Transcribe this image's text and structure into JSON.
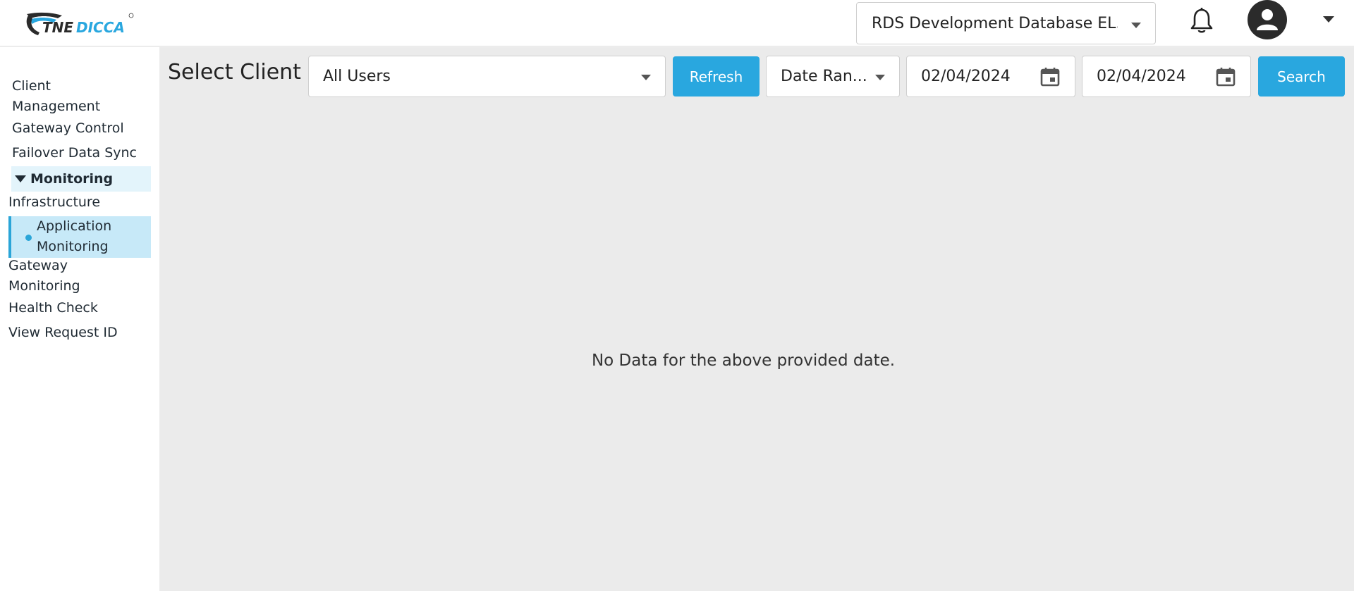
{
  "brand": {
    "logo_text": "TNEDICCA"
  },
  "header": {
    "database_select": "RDS Development Database EL...",
    "notifications_icon": "bell-icon",
    "user_icon": "user-avatar-icon"
  },
  "sidebar": {
    "items": [
      {
        "label": "Client\nManagement"
      },
      {
        "label": "Gateway Control"
      },
      {
        "label": "Failover Data Sync"
      },
      {
        "label": "Monitoring"
      },
      {
        "label": "Infrastructure"
      },
      {
        "label": "Application\nMonitoring"
      },
      {
        "label": "Gateway\nMonitoring"
      },
      {
        "label": "Health Check"
      },
      {
        "label": "View Request ID"
      }
    ]
  },
  "toolbar": {
    "select_client_label": "Select Client",
    "client_select": "All Users",
    "refresh_label": "Refresh",
    "date_range_select": "Date Ran...",
    "start_date": "02/04/2024",
    "end_date": "02/04/2024",
    "search_label": "Search"
  },
  "main": {
    "empty_message": "No Data for the above provided date."
  },
  "colors": {
    "accent": "#29a7df",
    "active_nav_bg": "#c7e9f8",
    "content_bg": "#ebebeb"
  }
}
